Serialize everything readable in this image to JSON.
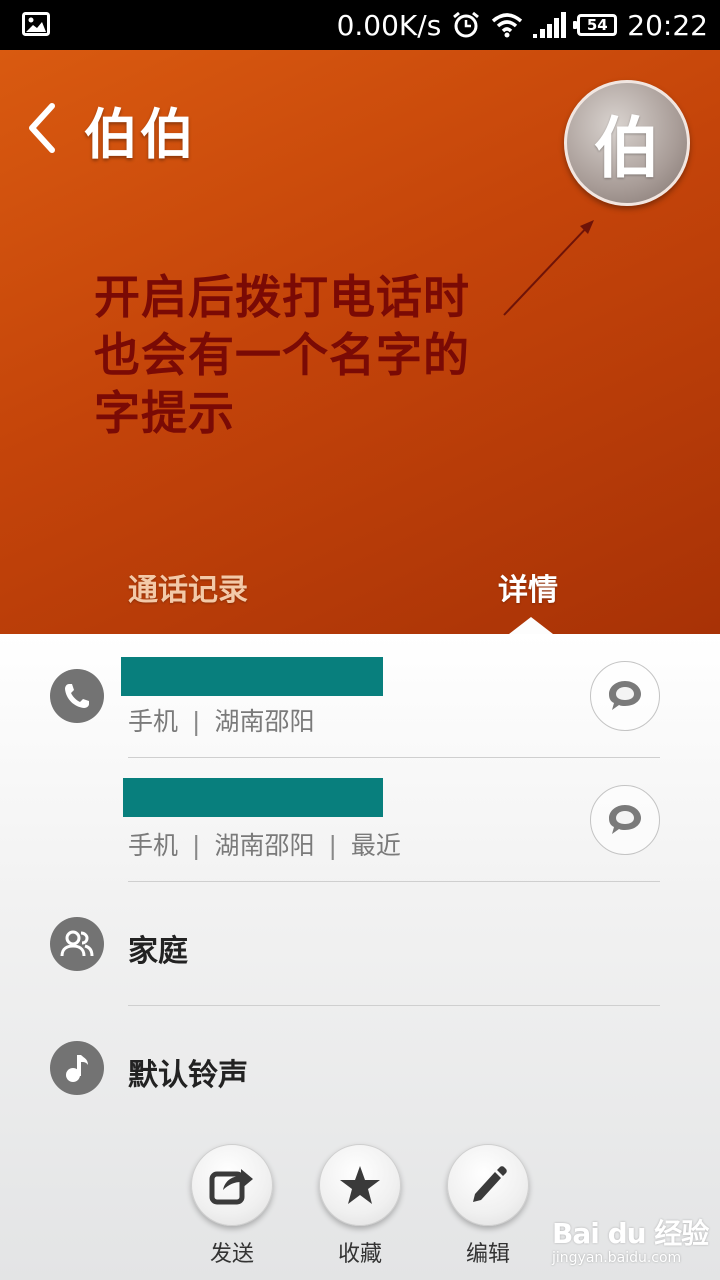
{
  "status_bar": {
    "speed": "0.00K/s",
    "battery": "54",
    "time": "20:22"
  },
  "header": {
    "contact_name": "伯伯",
    "avatar_char": "伯",
    "annotation_lines": [
      "开启后拨打电话时",
      "也会有一个名字的",
      "字提示"
    ],
    "tabs": [
      {
        "label": "通话记录",
        "active": false
      },
      {
        "label": "详情",
        "active": true
      }
    ]
  },
  "details": {
    "phones": [
      {
        "meta": [
          "手机",
          "湖南邵阳"
        ]
      },
      {
        "meta": [
          "手机",
          "湖南邵阳",
          "最近"
        ]
      }
    ],
    "meta_separator": "|",
    "group_label": "家庭",
    "ringtone_label": "默认铃声"
  },
  "actions": [
    {
      "label": "发送",
      "icon": "share-icon"
    },
    {
      "label": "收藏",
      "icon": "star-icon"
    },
    {
      "label": "编辑",
      "icon": "pencil-icon"
    }
  ],
  "watermark": {
    "main": "Bai du 经验",
    "sub": "jingyan.baidu.com"
  },
  "colors": {
    "header": "#c4440a",
    "annotation": "#7a0a05",
    "redaction": "#087f7d",
    "icon_bg": "#737373"
  }
}
